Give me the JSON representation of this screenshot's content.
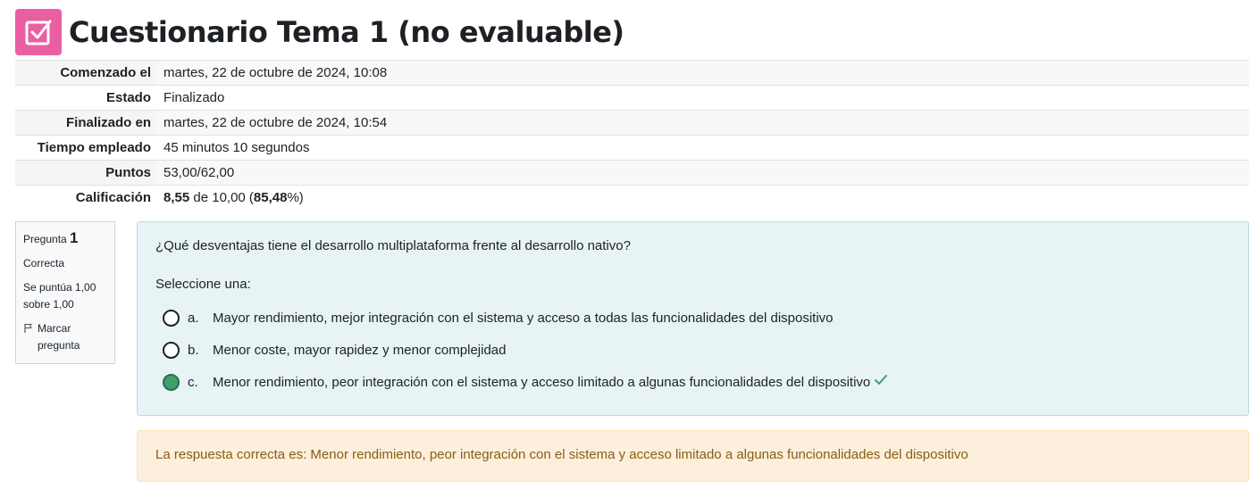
{
  "page": {
    "title": "Cuestionario Tema 1 (no evaluable)",
    "icon": "quiz-checkbox-icon",
    "accent_color": "#ea5fa2"
  },
  "summary": [
    {
      "label": "Comenzado el",
      "value": "martes, 22 de octubre de 2024, 10:08"
    },
    {
      "label": "Estado",
      "value": "Finalizado"
    },
    {
      "label": "Finalizado en",
      "value": "martes, 22 de octubre de 2024, 10:54"
    },
    {
      "label": "Tiempo empleado",
      "value": "45 minutos 10 segundos"
    },
    {
      "label": "Puntos",
      "value": "53,00/62,00"
    },
    {
      "label": "Calificación",
      "grade": "8,55",
      "grade_mid": " de 10,00 (",
      "percent": "85,48",
      "percent_end": "%)"
    }
  ],
  "question": {
    "prefix": "Pregunta",
    "number": "1",
    "state": "Correcta",
    "score": "Se puntúa 1,00 sobre 1,00",
    "flag_label": "Marcar pregunta",
    "text": "¿Qué desventajas tiene el desarrollo multiplataforma frente al desarrollo nativo?",
    "prompt": "Seleccione una:",
    "options": [
      {
        "letter": "a.",
        "text": "Mayor rendimiento, mejor integración con el sistema y acceso a todas las funcionalidades del dispositivo",
        "selected": false
      },
      {
        "letter": "b.",
        "text": "Menor coste, mayor rapidez y menor complejidad",
        "selected": false
      },
      {
        "letter": "c.",
        "text": "Menor rendimiento, peor integración con el sistema y acceso limitado a algunas funcionalidades del dispositivo",
        "selected": true,
        "correct": true
      }
    ],
    "feedback": "La respuesta correcta es: Menor rendimiento, peor integración con el sistema y acceso limitado a algunas funcionalidades del dispositivo"
  },
  "colors": {
    "correct_green": "#3f9f6d",
    "content_bg": "#e7f3f5",
    "feedback_bg": "#fcefdc",
    "feedback_text": "#8a5d13"
  }
}
